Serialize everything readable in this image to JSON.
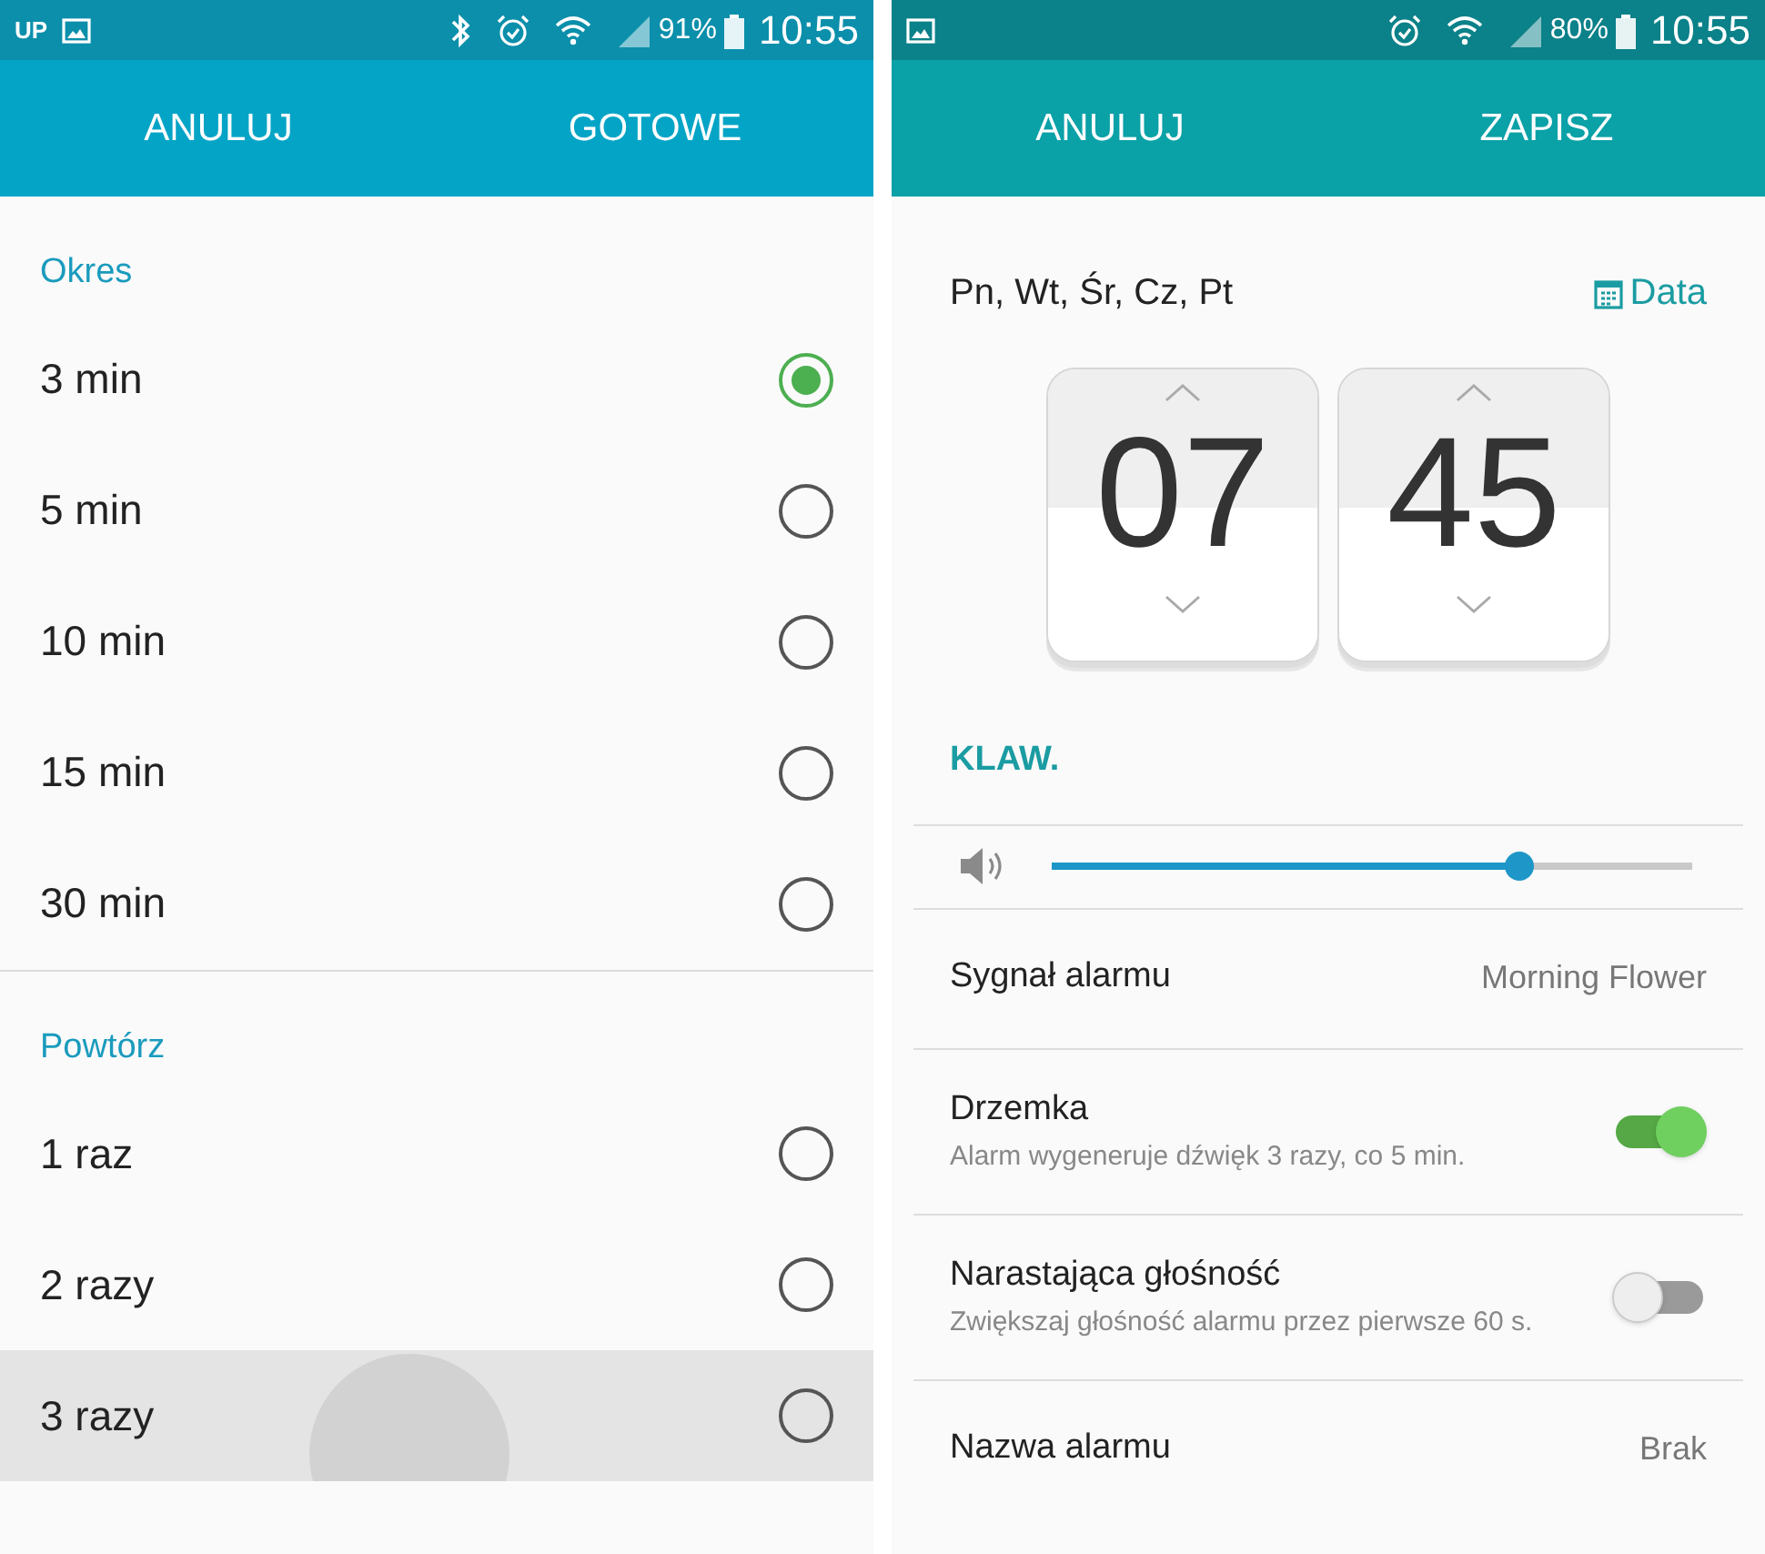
{
  "left_screen": {
    "status_bar": {
      "carrier": "UP",
      "bluetooth": true,
      "battery": "91%",
      "time": "10:55"
    },
    "header": {
      "cancel": "ANULUJ",
      "confirm": "GOTOWE"
    },
    "sections": [
      {
        "title": "Okres",
        "options": [
          {
            "label": "3 min",
            "selected": true,
            "pressed": false
          },
          {
            "label": "5 min",
            "selected": false,
            "pressed": false
          },
          {
            "label": "10 min",
            "selected": false,
            "pressed": false
          },
          {
            "label": "15 min",
            "selected": false,
            "pressed": false
          },
          {
            "label": "30 min",
            "selected": false,
            "pressed": false
          }
        ]
      },
      {
        "title": "Powtórz",
        "options": [
          {
            "label": "1 raz",
            "selected": false,
            "pressed": false
          },
          {
            "label": "2 razy",
            "selected": false,
            "pressed": false
          },
          {
            "label": "3 razy",
            "selected": false,
            "pressed": true
          }
        ]
      }
    ]
  },
  "right_screen": {
    "status_bar": {
      "battery": "80%",
      "time": "10:55"
    },
    "header": {
      "cancel": "ANULUJ",
      "confirm": "ZAPISZ"
    },
    "days": "Pn, Wt, Śr, Cz, Pt",
    "date_button": "Data",
    "hour": "07",
    "minute": "45",
    "keyboard_button": "KLAW.",
    "volume": {
      "level": 0.73
    },
    "settings": [
      {
        "kind": "value",
        "title": "Sygnał alarmu",
        "value": "Morning Flower"
      },
      {
        "kind": "toggle",
        "title": "Drzemka",
        "subtitle": "Alarm wygeneruje dźwięk 3 razy, co 5 min.",
        "on": true
      },
      {
        "kind": "toggle",
        "title": "Narastająca głośność",
        "subtitle": "Zwiększaj głośność alarmu przez pierwsze 60 s.",
        "on": false
      },
      {
        "kind": "value",
        "title": "Nazwa alarmu",
        "value": "Brak"
      }
    ]
  }
}
